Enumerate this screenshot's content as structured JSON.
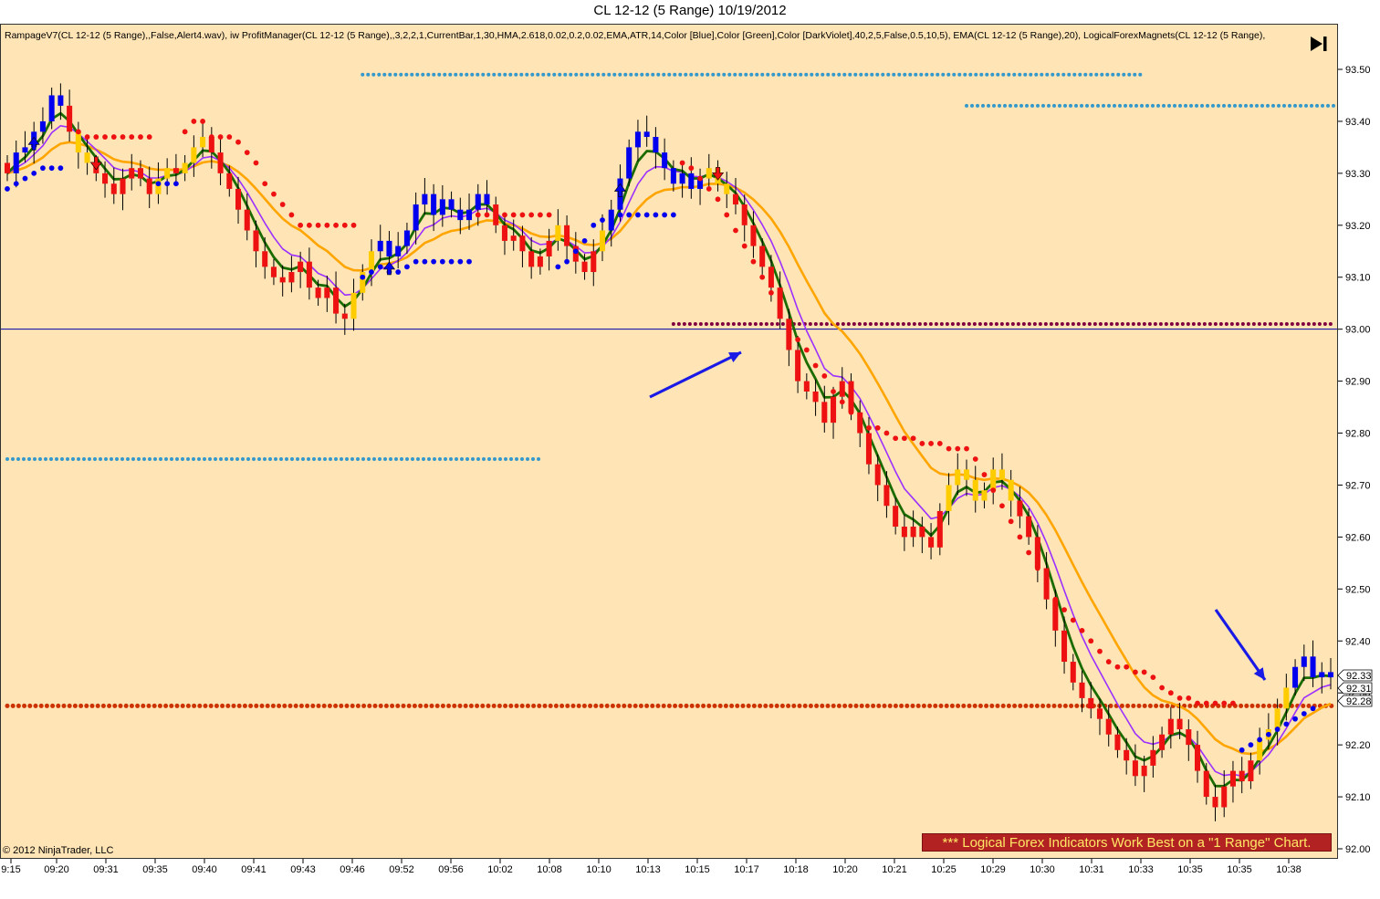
{
  "title": "CL 12-12 (5 Range)  10/19/2012",
  "indicator_text": "RampageV7(CL 12-12 (5 Range),,False,Alert4.wav), iw ProfitManager(CL 12-12 (5 Range),,3,2,2,1,CurrentBar,1,30,HMA,2.618,0.02,0.2,0.02,EMA,ATR,14,Color [Blue],Color [Green],Color [DarkViolet],40,2,5,False,0.5,10,5), EMA(CL 12-12 (5 Range),20), LogicalForexMagnets(CL 12-12 (5 Range),",
  "copyright": "© 2012 NinjaTrader, LLC",
  "banner": "*** Logical Forex Indicators Work Best on a \"1 Range\" Chart.",
  "icons": {
    "go_to_end": "skip-to-end-icon",
    "arrows": "blue-arrow-annotation-icon"
  },
  "colors": {
    "background": "#FFE4B5",
    "bull": "#0000EE",
    "bear": "#EE1111",
    "neutral": "#FFCC00",
    "green_line": "#1A6B00",
    "violet_line": "#9B30FF",
    "ema_line": "#FFA500",
    "stop_red": "#EE1111",
    "stop_blue": "#0000EE",
    "magnet_cyan": "#3399CC",
    "magnet_orange": "#CC3300",
    "magnet_maroon": "#800040",
    "h_line": "#0000AA"
  },
  "chart_data": {
    "type": "candlestick",
    "title": "CL 12-12 (5 Range)  10/19/2012",
    "ylim": [
      92.0,
      93.55
    ],
    "y_ticks": [
      "93.50",
      "93.40",
      "93.30",
      "93.20",
      "93.10",
      "93.00",
      "92.90",
      "92.80",
      "92.70",
      "92.60",
      "92.50",
      "92.40",
      "92.30",
      "92.20",
      "92.10",
      "92.00"
    ],
    "x_ticks": [
      "9:15",
      "09:20",
      "09:31",
      "09:35",
      "09:40",
      "09:41",
      "09:43",
      "09:46",
      "09:52",
      "09:56",
      "10:02",
      "10:08",
      "10:10",
      "10:13",
      "10:15",
      "10:17",
      "10:18",
      "10:20",
      "10:21",
      "10:25",
      "10:29",
      "10:30",
      "10:31",
      "10:33",
      "10:35",
      "10:35",
      "10:38"
    ],
    "price_labels": [
      "92.33",
      "92.31",
      "92.28"
    ],
    "horizontal_line": 93.0,
    "magnet_levels": [
      {
        "price": 93.49,
        "from_bar": 40,
        "to_bar": 128,
        "color_key": "magnet_cyan"
      },
      {
        "price": 93.43,
        "from_bar": 108,
        "to_bar": 162,
        "color_key": "magnet_cyan"
      },
      {
        "price": 92.75,
        "from_bar": 0,
        "to_bar": 60,
        "color_key": "magnet_cyan"
      },
      {
        "price": 93.01,
        "from_bar": 75,
        "to_bar": 162,
        "color_key": "magnet_maroon"
      },
      {
        "price": 92.275,
        "from_bar": 0,
        "to_bar": 162,
        "color_key": "magnet_orange"
      }
    ],
    "closes": [
      93.3,
      93.34,
      93.35,
      93.38,
      93.4,
      93.45,
      93.43,
      93.38,
      93.34,
      93.32,
      93.3,
      93.28,
      93.26,
      93.29,
      93.31,
      93.29,
      93.26,
      93.29,
      93.31,
      93.3,
      93.32,
      93.35,
      93.37,
      93.34,
      93.3,
      93.27,
      93.23,
      93.19,
      93.15,
      93.12,
      93.1,
      93.09,
      93.11,
      93.13,
      93.08,
      93.06,
      93.08,
      93.03,
      93.02,
      93.07,
      93.11,
      93.15,
      93.17,
      93.14,
      93.16,
      93.19,
      93.24,
      93.26,
      93.22,
      93.25,
      93.23,
      93.21,
      93.23,
      93.26,
      93.24,
      93.2,
      93.17,
      93.18,
      93.15,
      93.12,
      93.14,
      93.17,
      93.2,
      93.16,
      93.13,
      93.11,
      93.15,
      93.19,
      93.23,
      93.29,
      93.35,
      93.38,
      93.37,
      93.34,
      93.31,
      93.28,
      93.3,
      93.27,
      93.29,
      93.31,
      93.28,
      93.26,
      93.24,
      93.2,
      93.16,
      93.12,
      93.08,
      93.02,
      92.96,
      92.9,
      92.88,
      92.86,
      92.82,
      92.87,
      92.9,
      92.84,
      92.8,
      92.74,
      92.7,
      92.66,
      92.62,
      92.6,
      92.62,
      92.6,
      92.58,
      92.65,
      92.7,
      92.73,
      92.71,
      92.67,
      92.69,
      92.73,
      92.71,
      92.67,
      92.64,
      92.6,
      92.54,
      92.48,
      92.42,
      92.36,
      92.32,
      92.29,
      92.27,
      92.25,
      92.22,
      92.19,
      92.17,
      92.14,
      92.16,
      92.19,
      92.22,
      92.25,
      92.23,
      92.2,
      92.15,
      92.1,
      92.08,
      92.12,
      92.15,
      92.13,
      92.17,
      92.21,
      92.23,
      92.27,
      92.31,
      92.35,
      92.37,
      92.33,
      92.34,
      92.33
    ],
    "colors": [
      "bear",
      "bull",
      "bull",
      "bull",
      "bull",
      "bull",
      "bull",
      "bear",
      "neutral",
      "neutral",
      "bear",
      "bear",
      "bear",
      "bear",
      "bear",
      "bear",
      "bear",
      "neutral",
      "neutral",
      "bear",
      "neutral",
      "neutral",
      "neutral",
      "bear",
      "bear",
      "bear",
      "bear",
      "bear",
      "bear",
      "bear",
      "bear",
      "bear",
      "bear",
      "bear",
      "bear",
      "bear",
      "bear",
      "bear",
      "bear",
      "neutral",
      "neutral",
      "neutral",
      "bull",
      "bull",
      "bull",
      "bull",
      "bull",
      "bull",
      "bull",
      "bull",
      "bull",
      "bull",
      "bull",
      "bull",
      "bull",
      "bear",
      "bear",
      "bear",
      "bear",
      "bear",
      "bear",
      "bear",
      "neutral",
      "bear",
      "bear",
      "bear",
      "bear",
      "neutral",
      "bull",
      "bull",
      "bull",
      "bull",
      "bull",
      "bull",
      "bull",
      "bull",
      "bull",
      "bull",
      "bull",
      "neutral",
      "neutral",
      "neutral",
      "bear",
      "bear",
      "bear",
      "bear",
      "bear",
      "bear",
      "bear",
      "bear",
      "bear",
      "bear",
      "bear",
      "bear",
      "bear",
      "bear",
      "bear",
      "bear",
      "bear",
      "bear",
      "bear",
      "bear",
      "bear",
      "bear",
      "bear",
      "bear",
      "neutral",
      "neutral",
      "neutral",
      "neutral",
      "neutral",
      "neutral",
      "neutral",
      "neutral",
      "bear",
      "bear",
      "bear",
      "bear",
      "bear",
      "bear",
      "bear",
      "bear",
      "bear",
      "bear",
      "bear",
      "bear",
      "bear",
      "bear",
      "bear",
      "bear",
      "bear",
      "bear",
      "bear",
      "bear",
      "bear",
      "bear",
      "bear",
      "bear",
      "bear",
      "bear",
      "bear",
      "neutral",
      "neutral",
      "neutral",
      "neutral",
      "bull",
      "bull",
      "bull",
      "bull",
      "bull",
      "bull",
      "bull"
    ],
    "stops": [
      93.27,
      93.28,
      93.29,
      93.3,
      93.31,
      93.31,
      93.31,
      93.39,
      93.38,
      93.37,
      93.37,
      93.37,
      93.37,
      93.37,
      93.37,
      93.37,
      93.37,
      93.28,
      93.28,
      93.28,
      93.38,
      93.4,
      93.4,
      93.37,
      93.37,
      93.37,
      93.36,
      93.34,
      93.32,
      93.28,
      93.26,
      93.24,
      93.22,
      93.2,
      93.2,
      93.2,
      93.2,
      93.2,
      93.2,
      93.2,
      93.1,
      93.11,
      93.12,
      93.11,
      93.11,
      93.12,
      93.13,
      93.13,
      93.13,
      93.13,
      93.13,
      93.13,
      93.13,
      93.22,
      93.22,
      93.22,
      93.22,
      93.22,
      93.22,
      93.22,
      93.22,
      93.22,
      93.12,
      93.13,
      93.15,
      93.17,
      93.2,
      93.21,
      93.22,
      93.22,
      93.22,
      93.22,
      93.22,
      93.22,
      93.22,
      93.22,
      93.32,
      93.31,
      93.29,
      93.27,
      93.25,
      93.22,
      93.19,
      93.16,
      93.13,
      93.1,
      93.07,
      93.04,
      93.01,
      92.98,
      92.96,
      92.93,
      92.91,
      92.88,
      92.86,
      92.84,
      92.82,
      92.81,
      92.81,
      92.8,
      92.79,
      92.79,
      92.79,
      92.78,
      92.78,
      92.78,
      92.77,
      92.77,
      92.77,
      92.75,
      92.72,
      92.69,
      92.66,
      92.63,
      92.6,
      92.57,
      92.54,
      92.51,
      92.48,
      92.46,
      92.44,
      92.42,
      92.4,
      92.38,
      92.36,
      92.35,
      92.35,
      92.34,
      92.34,
      92.33,
      92.31,
      92.3,
      92.29,
      92.29,
      92.28,
      92.28,
      92.28,
      92.28,
      92.28,
      92.19,
      92.2,
      92.21,
      92.22,
      92.23,
      92.24,
      92.25,
      92.26,
      92.27
    ],
    "stop_colors": [
      "blue",
      "blue",
      "blue",
      "blue",
      "blue",
      "blue",
      "blue",
      "red",
      "red",
      "red",
      "red",
      "red",
      "red",
      "red",
      "red",
      "red",
      "red",
      "blue",
      "blue",
      "blue",
      "red",
      "red",
      "red",
      "red",
      "red",
      "red",
      "red",
      "red",
      "red",
      "red",
      "red",
      "red",
      "red",
      "red",
      "red",
      "red",
      "red",
      "red",
      "red",
      "red",
      "blue",
      "blue",
      "blue",
      "blue",
      "blue",
      "blue",
      "blue",
      "blue",
      "blue",
      "blue",
      "blue",
      "blue",
      "blue",
      "red",
      "red",
      "red",
      "red",
      "red",
      "red",
      "red",
      "red",
      "red",
      "blue",
      "blue",
      "blue",
      "blue",
      "blue",
      "blue",
      "blue",
      "blue",
      "blue",
      "blue",
      "blue",
      "blue",
      "blue",
      "blue",
      "red",
      "red",
      "red",
      "red",
      "red",
      "red",
      "red",
      "red",
      "red",
      "red",
      "red",
      "red",
      "red",
      "red",
      "red",
      "red",
      "red",
      "red",
      "red",
      "red",
      "red",
      "red",
      "red",
      "red",
      "red",
      "red",
      "red",
      "red",
      "red",
      "red",
      "red",
      "red",
      "red",
      "red",
      "red",
      "red",
      "red",
      "red",
      "red",
      "red",
      "red",
      "red",
      "red",
      "red",
      "red",
      "red",
      "red",
      "red",
      "red",
      "red",
      "red",
      "red",
      "red",
      "red",
      "red",
      "red",
      "red",
      "red",
      "red",
      "red",
      "red",
      "red",
      "red",
      "blue",
      "blue",
      "blue",
      "blue",
      "blue",
      "blue",
      "blue",
      "blue",
      "blue"
    ],
    "up_arrows_at": [
      3,
      43,
      69
    ],
    "down_arrows_at": [
      10,
      80
    ],
    "annotation_arrows": [
      {
        "from": [
          66,
          92.88
        ],
        "to": [
          73,
          92.96
        ]
      },
      {
        "from": [
          147,
          92.42
        ],
        "to": [
          150,
          92.3
        ]
      }
    ]
  }
}
